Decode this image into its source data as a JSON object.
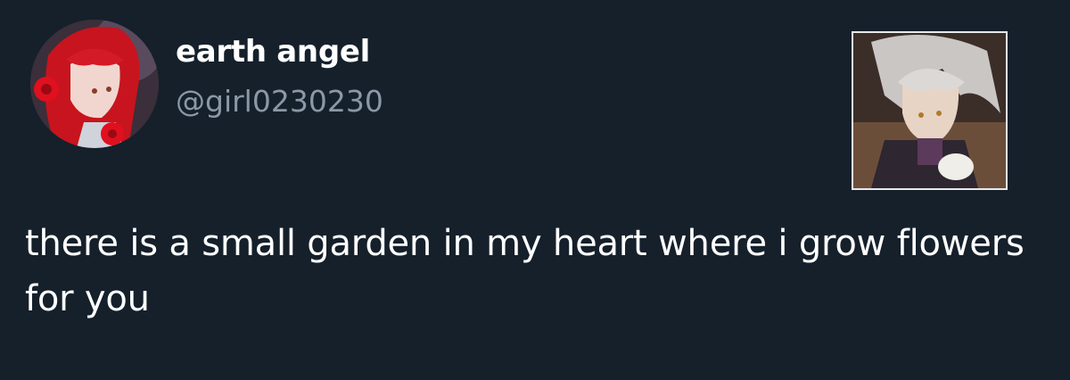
{
  "user": {
    "display_name": "earth angel",
    "handle": "@girl0230230",
    "avatar_icon": "profile-avatar"
  },
  "tweet": {
    "text": "there is a small garden in my heart where i grow flowers for you",
    "media_icon": "attached-image"
  },
  "colors": {
    "background": "#15202b",
    "name": "#ffffff",
    "handle": "#8b98a5",
    "body_text": "#ffffff"
  }
}
